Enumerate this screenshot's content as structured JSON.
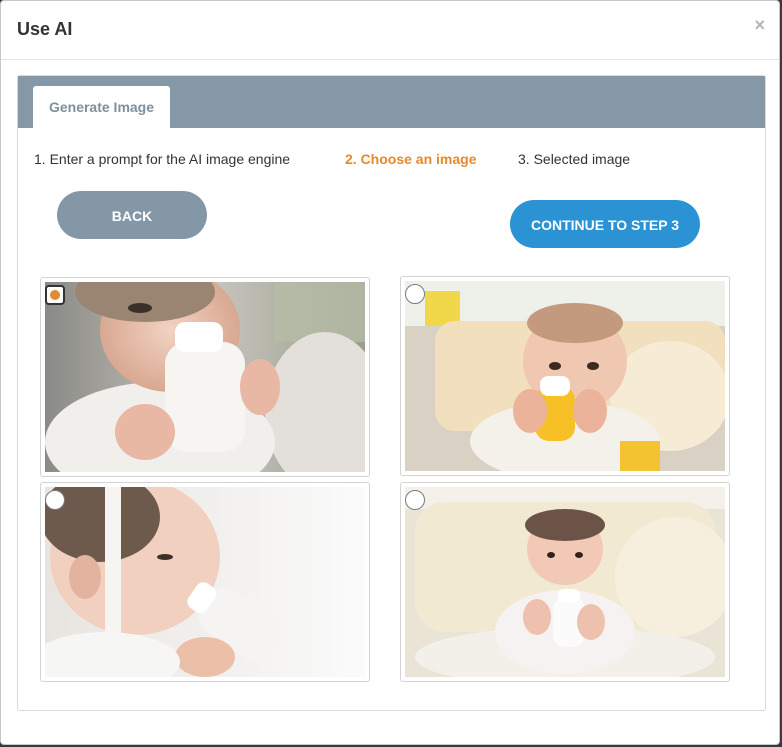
{
  "modal": {
    "title": "Use AI",
    "close_glyph": "×"
  },
  "tabs": [
    {
      "label": "Generate Image"
    }
  ],
  "steps": [
    {
      "label": "1. Enter a prompt for the AI image engine"
    },
    {
      "label": "2. Choose an image",
      "active": true
    },
    {
      "label": "3. Selected image"
    }
  ],
  "buttons": {
    "back_label": "BACK",
    "continue_label": "CONTINUE TO STEP 3"
  },
  "images": [
    {
      "name": "baby-with-bottle-1",
      "selected": true
    },
    {
      "name": "baby-with-bottle-2",
      "selected": false
    },
    {
      "name": "baby-with-bottle-3",
      "selected": false
    },
    {
      "name": "baby-with-bottle-4",
      "selected": false
    }
  ],
  "colors": {
    "accent_orange": "#e58a2c",
    "continue_blue": "#2b92d4",
    "back_gray": "#8497a7",
    "tabbar_gray": "#8498a8"
  }
}
